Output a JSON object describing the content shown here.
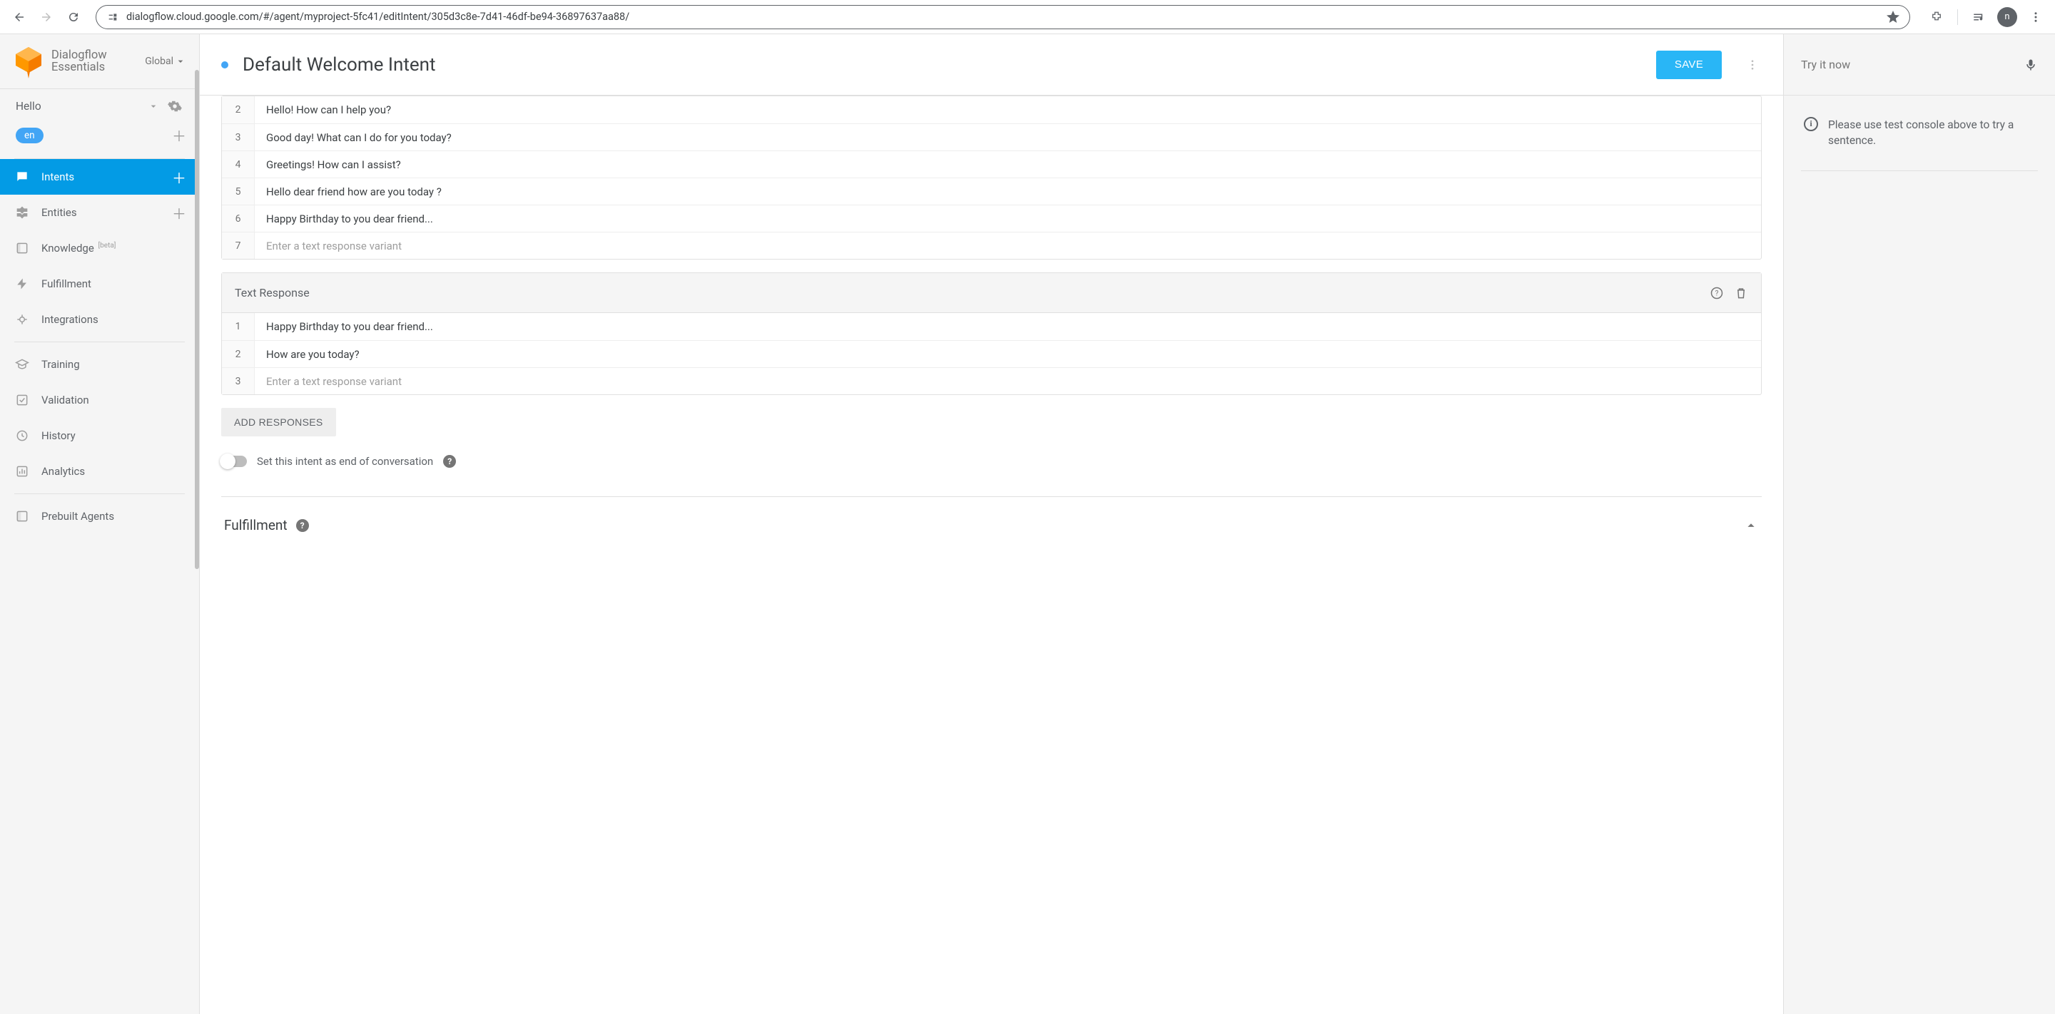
{
  "browser": {
    "url": "dialogflow.cloud.google.com/#/agent/myproject-5fc41/editIntent/305d3c8e-7d41-46df-be94-36897637aa88/",
    "avatar_letter": "n"
  },
  "brand": {
    "line1": "Dialogflow",
    "line2": "Essentials",
    "global": "Global"
  },
  "agent": {
    "name": "Hello",
    "lang": "en"
  },
  "nav": {
    "intents": "Intents",
    "entities": "Entities",
    "knowledge": "Knowledge",
    "knowledge_badge": "[beta]",
    "fulfillment": "Fulfillment",
    "integrations": "Integrations",
    "training": "Training",
    "validation": "Validation",
    "history": "History",
    "analytics": "Analytics",
    "prebuilt": "Prebuilt Agents"
  },
  "header": {
    "title": "Default Welcome Intent",
    "save": "SAVE"
  },
  "responses1": [
    "Hello! How can I help you?",
    "Good day! What can I do for you today?",
    "Greetings! How can I assist?",
    "Hello dear friend how are you today ?",
    "Happy Birthday to you dear friend..."
  ],
  "responses1_start": 2,
  "response_placeholder": "Enter a text response variant",
  "card2_title": "Text Response",
  "responses2": [
    "Happy Birthday to you dear friend...",
    "How are you today?"
  ],
  "add_responses": "ADD RESPONSES",
  "eoc_label": "Set this intent as end of conversation",
  "fulfillment_section": "Fulfillment",
  "test": {
    "title": "Try it now",
    "hint": "Please use test console above to try a sentence."
  }
}
